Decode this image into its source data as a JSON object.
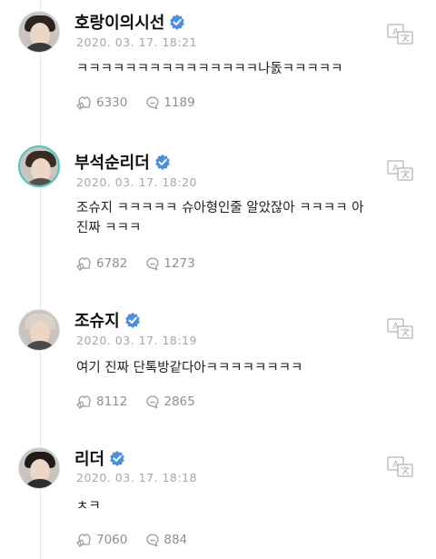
{
  "comments": [
    {
      "author": "호랑이의시선",
      "timestamp": "2020. 03. 17. 18:21",
      "text": "ㅋㅋㅋㅋㅋㅋㅋㅋㅋㅋㅋㅋㅋㅋㅋ나돐ㅋㅋㅋㅋㅋ",
      "likes": "6330",
      "replies": "1189"
    },
    {
      "author": "부석순리더",
      "timestamp": "2020. 03. 17. 18:20",
      "text": "조슈지 ㅋㅋㅋㅋㅋ 슈아형인줄 알았잖아 ㅋㅋㅋㅋ 아진짜 ㅋㅋㅋ",
      "likes": "6782",
      "replies": "1273"
    },
    {
      "author": "조슈지",
      "timestamp": "2020. 03. 17. 18:19",
      "text": "여기 진짜 단톡방같다아ㅋㅋㅋㅋㅋㅋㅋㅋ",
      "likes": "8112",
      "replies": "2865"
    },
    {
      "author": "리더",
      "timestamp": "2020. 03. 17. 18:18",
      "text": "ㅊㅋ",
      "likes": "7060",
      "replies": "884"
    }
  ],
  "icons": {
    "verified": "verified-badge-icon",
    "translate": "translate-icon",
    "like": "like-icon",
    "reply": "reply-icon",
    "verified_color": "#4a90e2",
    "avatar_ring_color": "#49c7c0"
  }
}
